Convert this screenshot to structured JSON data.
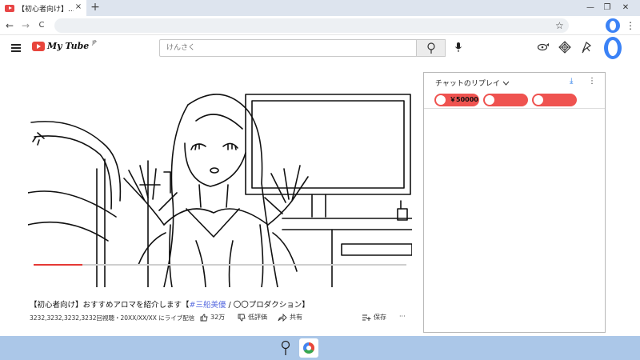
{
  "browser": {
    "tab_title": "【初心者向け】...",
    "tab_close": "×",
    "new_tab": "+",
    "window_controls": {
      "minimize": "—",
      "restore": "❐",
      "close": "✕"
    },
    "nav": {
      "back": "←",
      "forward": "→",
      "reload": "C"
    },
    "bookmark": "☆",
    "menu": "⋮"
  },
  "site": {
    "logo_text": "My Tube",
    "logo_sup": "JP",
    "search_placeholder": "けんさく"
  },
  "video": {
    "progress_fraction": 0.13,
    "title_prefix": "【初心者向け】おすすめアロマを紹介します【",
    "title_tag": "#三船美優",
    "title_suffix": " / 〇〇プロダクション】",
    "meta": "3232,3232,3232,3232回視聴・20XX/XX/XX にライブ配信",
    "likes": "32万",
    "dislike": "低評価",
    "share": "共有",
    "save": "保存",
    "more": "···"
  },
  "chat": {
    "title": "チャットのリプレイ",
    "download": "⤓",
    "menu": "⋮",
    "superchats": [
      {
        "amount": "￥50000"
      },
      {
        "amount": ""
      },
      {
        "amount": ""
      }
    ]
  },
  "colors": {
    "accent_red": "#ef5350",
    "brand_red": "#e8453c",
    "profile_blue": "#3b82f6",
    "taskbar": "#abc7e8",
    "hashtag": "#5b6ee1"
  },
  "icons": {
    "search": "search-icon",
    "mic": "mic-icon",
    "create": "create-icon",
    "apps": "apps-icon",
    "notifications": "notifications-icon"
  }
}
